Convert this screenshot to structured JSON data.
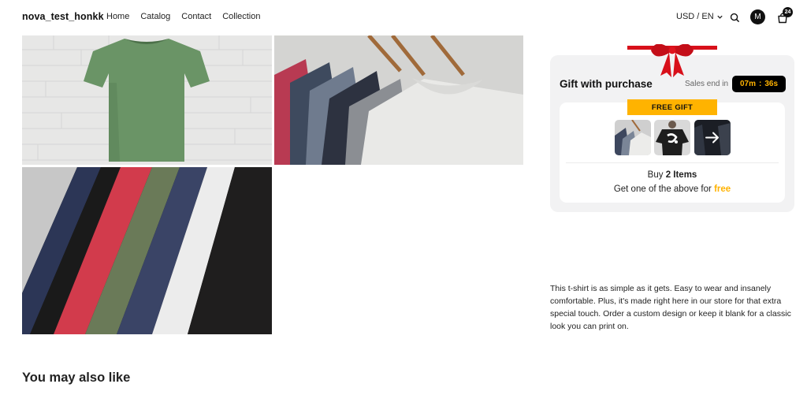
{
  "header": {
    "brand": "nova_test_honkk",
    "nav": [
      "Home",
      "Catalog",
      "Contact",
      "Collection"
    ],
    "locale": "USD / EN",
    "avatar_initial": "M",
    "cart_count": "24",
    "icons": [
      "chevron-down-icon",
      "search-icon",
      "cart-icon"
    ]
  },
  "gallery": {
    "images": [
      "green-tshirt-on-brick-wall",
      "tshirts-on-hangers",
      "folded-tshirts-fan"
    ]
  },
  "gift": {
    "title": "Gift with purchase",
    "sales_label": "Sales end in",
    "timer_minutes": "07m",
    "timer_sep": ":",
    "timer_seconds": "36s",
    "free_tag": "FREE GIFT",
    "buy_prefix": "Buy ",
    "buy_count": "2 Items",
    "get_prefix": "Get one of the above for ",
    "get_free": "free",
    "accent": "#ffb300",
    "ribbon_color": "#d8101a"
  },
  "description": "This t-shirt is as simple as it gets. Easy to wear and insanely comfortable. Plus, it's made right here in our store for that extra special touch. Order a custom design or keep it blank for a classic look you can print on.",
  "related": {
    "heading": "You may also like"
  }
}
